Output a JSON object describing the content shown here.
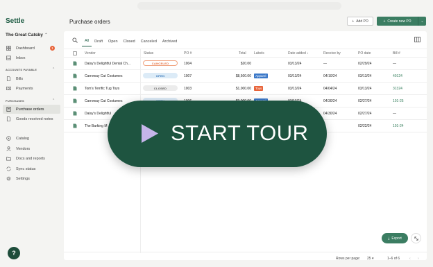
{
  "app": {
    "logo": "Settle",
    "company": "The Great Catsby"
  },
  "sidebar": {
    "top_items": [
      {
        "label": "Dashboard",
        "icon": "grid-icon",
        "badge": "1"
      },
      {
        "label": "Inbox",
        "icon": "inbox-icon"
      }
    ],
    "sections": [
      {
        "label": "ACCOUNTS PAYABLE",
        "items": [
          {
            "label": "Bills",
            "icon": "document-icon"
          },
          {
            "label": "Payments",
            "icon": "dollar-icon"
          }
        ]
      },
      {
        "label": "PURCHASES",
        "items": [
          {
            "label": "Purchase orders",
            "icon": "purchase-order-icon",
            "active": true
          },
          {
            "label": "Goods received notes",
            "icon": "document-icon"
          }
        ]
      }
    ],
    "bottom_items": [
      {
        "label": "Catalog",
        "icon": "catalog-icon"
      },
      {
        "label": "Vendors",
        "icon": "vendors-icon"
      },
      {
        "label": "Docs and reports",
        "icon": "folder-icon"
      },
      {
        "label": "Sync status",
        "icon": "sync-icon"
      },
      {
        "label": "Settings",
        "icon": "gear-icon"
      }
    ],
    "help_label": "?"
  },
  "header": {
    "title": "Purchase orders",
    "add_po": "Add PO",
    "create_new_po": "Create new PO"
  },
  "tabs": [
    "All",
    "Draft",
    "Open",
    "Closed",
    "Canceled",
    "Archived"
  ],
  "table": {
    "columns": [
      "Vendor",
      "Status",
      "PO #",
      "Total",
      "Labels",
      "Date added",
      "Receive by",
      "PO date",
      "Bill #"
    ],
    "rows": [
      {
        "vendor": "Daisy's Delightful Dental Ch...",
        "status": "CANCELED",
        "status_type": "cancelled",
        "po": "1004",
        "total": "$20.00",
        "label": "",
        "date_added": "03/13/24",
        "receive_by": "—",
        "po_date": "02/29/24",
        "bill": "—"
      },
      {
        "vendor": "Carroway Cat Costumes",
        "status": "OPEN",
        "status_type": "open",
        "po": "1007",
        "total": "$8,500.00",
        "label": "Apparel",
        "label_color": "#3b78c8",
        "date_added": "03/13/24",
        "receive_by": "04/10/24",
        "po_date": "03/13/24",
        "bill": "40124"
      },
      {
        "vendor": "Tom's Terrific Tug Toys",
        "status": "CLOSED",
        "status_type": "closed",
        "po": "1003",
        "total": "$1,000.00",
        "label": "Toys",
        "label_color": "#e8643a",
        "date_added": "03/13/24",
        "receive_by": "04/04/24",
        "po_date": "03/13/24",
        "bill": "31324"
      },
      {
        "vendor": "Carroway Cat Costumes",
        "status": "OPEN",
        "status_type": "open",
        "po": "1006",
        "total": "$9,000.00",
        "label": "Apparel",
        "label_color": "#3b78c8",
        "date_added": "03/13/24",
        "receive_by": "04/30/24",
        "po_date": "02/27/24",
        "bill": "101-25"
      },
      {
        "vendor": "Daisy's Delightful",
        "status": "",
        "status_type": "",
        "po": "",
        "total": "",
        "label": "",
        "date_added": "",
        "receive_by": "04/30/24",
        "po_date": "02/27/24",
        "bill": "—"
      },
      {
        "vendor": "The Barking M",
        "status": "",
        "status_type": "",
        "po": "",
        "total": "",
        "label": "",
        "date_added": "",
        "receive_by": "",
        "po_date": "02/22/24",
        "bill": "101-24"
      }
    ]
  },
  "footer": {
    "rows_per_page_label": "Rows per page:",
    "rows_per_page": "25",
    "range": "1–6 of 6"
  },
  "export_label": "Export",
  "tour": {
    "label": "START TOUR"
  },
  "colors": {
    "brand": "#1d5b43",
    "button": "#3b7d62",
    "tour_bg": "#1e5440",
    "play": "#c6b5ea"
  }
}
